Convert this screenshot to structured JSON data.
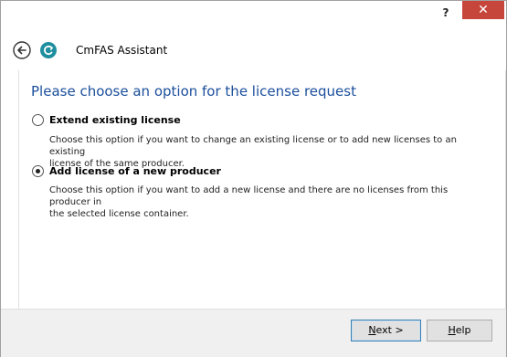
{
  "titlebar": {
    "help_label": "?",
    "close_label": "✕"
  },
  "header": {
    "title": "CmFAS Assistant",
    "back_icon": "back-arrow-icon",
    "app_icon": "codemeter-icon"
  },
  "main": {
    "heading": "Please choose an option for the license request",
    "options": [
      {
        "label": "Extend existing license",
        "selected": false,
        "description_line1": "Choose this option if you want to change an existing license or to add new licenses to an existing",
        "description_line2": "license of the same producer."
      },
      {
        "label": "Add license of a new producer",
        "selected": true,
        "description_line1": "Choose this option if you want to add a new license and there are no licenses from this producer in",
        "description_line2": "the selected license container."
      }
    ]
  },
  "footer": {
    "next_mnemonic": "N",
    "next_rest": "ext >",
    "help_mnemonic": "H",
    "help_rest": "elp"
  },
  "colors": {
    "heading": "#1b4f9c",
    "close_button": "#c7463c",
    "app_icon": "#1f8f9f"
  }
}
